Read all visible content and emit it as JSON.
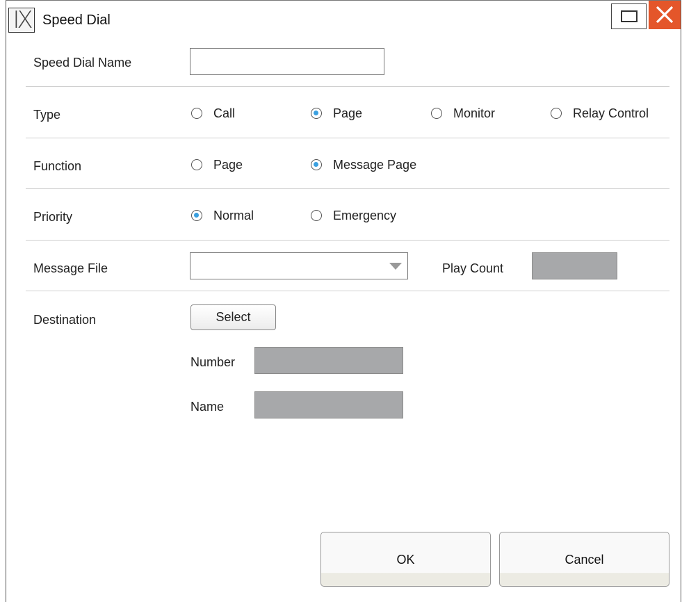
{
  "window": {
    "logo_text": "IX",
    "title": "Speed Dial",
    "maximize_icon": "maximize-icon",
    "close_icon": "close-icon",
    "close_color": "#e4562a"
  },
  "form": {
    "speed_dial_name": {
      "label": "Speed Dial Name",
      "value": ""
    },
    "type": {
      "label": "Type",
      "options": [
        "Call",
        "Page",
        "Monitor",
        "Relay Control"
      ],
      "selected": "Page"
    },
    "function": {
      "label": "Function",
      "options": [
        "Page",
        "Message Page"
      ],
      "selected": "Message Page"
    },
    "priority": {
      "label": "Priority",
      "options": [
        "Normal",
        "Emergency"
      ],
      "selected": "Normal"
    },
    "message_file": {
      "label": "Message File",
      "value": "",
      "icon": "chevron-down-icon"
    },
    "play_count": {
      "label": "Play Count",
      "value": ""
    },
    "destination": {
      "label": "Destination",
      "select_label": "Select",
      "number_label": "Number",
      "number_value": "",
      "name_label": "Name",
      "name_value": ""
    }
  },
  "footer": {
    "ok_label": "OK",
    "cancel_label": "Cancel"
  },
  "colors": {
    "radio_selected": "#3aa0e0",
    "disabled_field": "#a7a8aa"
  }
}
